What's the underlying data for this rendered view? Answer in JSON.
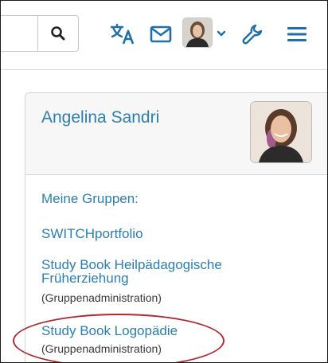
{
  "colors": {
    "link": "#2a7fb2",
    "icon": "#1f6fa8",
    "card_header_bg": "#f7f7f7",
    "annotation_ring": "#b1282e"
  },
  "header": {
    "icons": [
      "search-icon",
      "translate-icon",
      "mail-icon",
      "avatar",
      "chevron-down-icon",
      "wrench-icon",
      "hamburger-menu-icon"
    ]
  },
  "profile_card": {
    "name": "Angelina Sandri",
    "groups_label": "Meine Gruppen:",
    "groups": [
      {
        "name": "SWITCHportfolio",
        "role": ""
      },
      {
        "name_line1": "Study Book Heilpädagogische",
        "name_line2": "Früherziehung",
        "role": "(Gruppenadministration)"
      },
      {
        "name": "Study Book Logopädie",
        "role": "(Gruppenadministration)"
      }
    ]
  }
}
